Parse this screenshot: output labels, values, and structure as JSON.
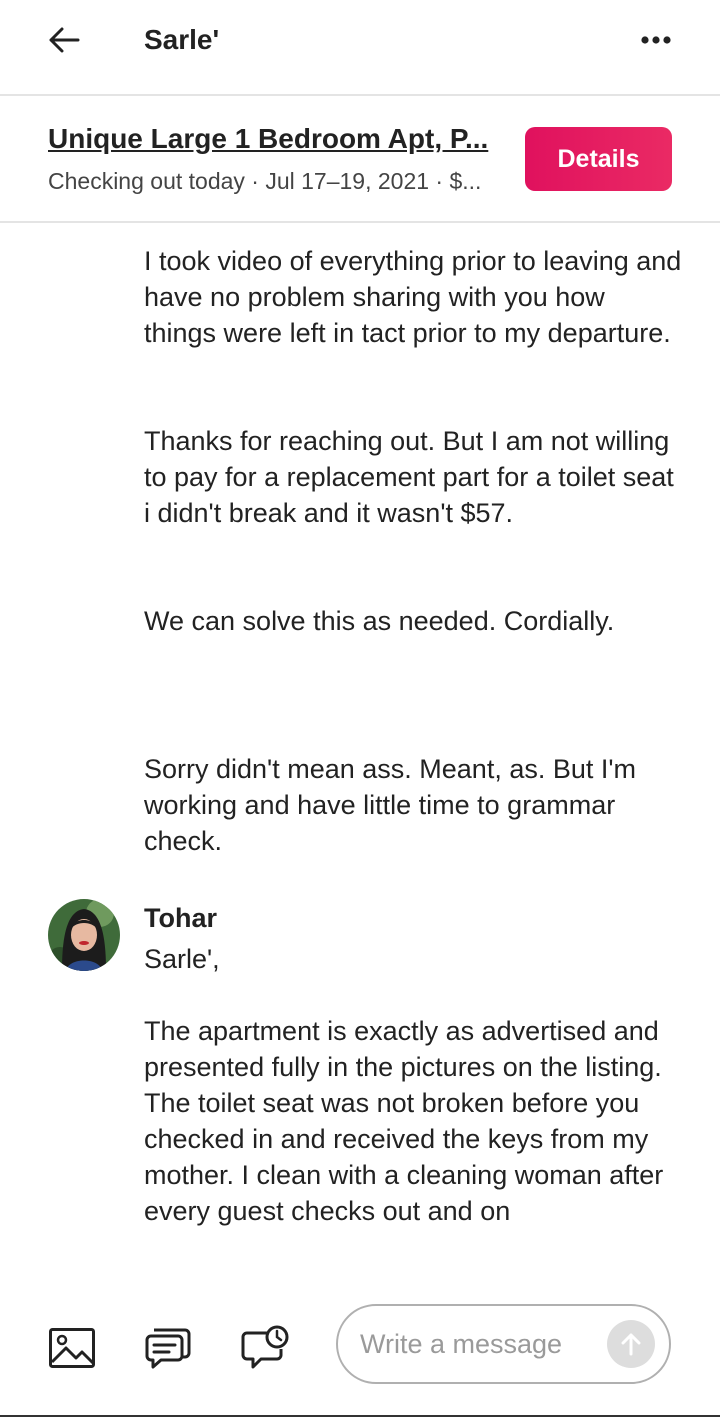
{
  "header": {
    "title": "Sarle'",
    "back_icon": "arrow-left-icon",
    "more_icon": "more-horizontal-icon"
  },
  "listing": {
    "title": "Unique Large 1 Bedroom Apt, P...",
    "subtitle": "Checking out today · Jul 17–19, 2021 · $...",
    "details_label": "Details",
    "accent_color": "#e31c5f"
  },
  "messages": {
    "previous_para1": "I took video of everything prior to leaving and have no problem sharing with you how things were left in tact prior to my departure.",
    "previous_para2": "Thanks for reaching out. But I am not willing to pay for a replacement part for a toilet seat i didn't break and it wasn't $57.",
    "previous_para3": "We can solve this as needed. Cordially.",
    "followup": "Sorry didn't mean ass. Meant, as. But I'm working and have little time to grammar check.",
    "reply": {
      "sender": "Tohar",
      "greeting": "Sarle',",
      "body": "The apartment is exactly as advertised and presented fully in the pictures on the listing. The toilet seat was not broken before you checked in and received the keys from my mother. I clean with a cleaning woman after every guest checks out and on"
    }
  },
  "composer": {
    "placeholder": "Write a message",
    "tools": [
      "image-icon",
      "quick-replies-icon",
      "scheduled-message-icon"
    ],
    "send_icon": "arrow-up-icon"
  }
}
